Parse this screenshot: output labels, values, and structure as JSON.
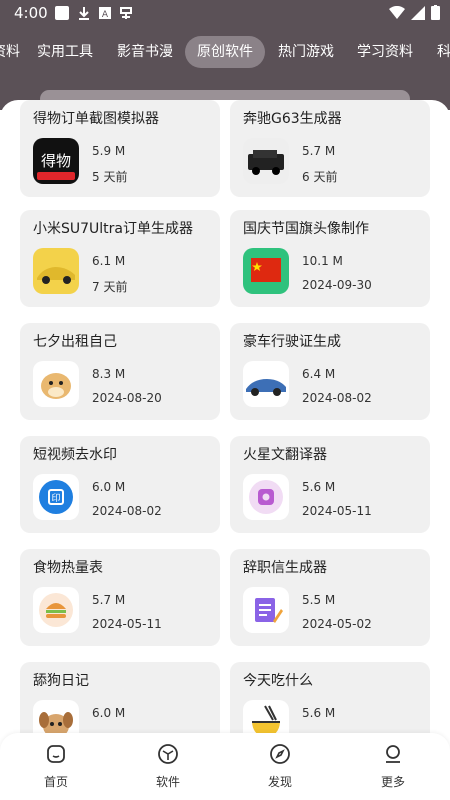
{
  "status_bar": {
    "time": "4:00"
  },
  "tabs": [
    {
      "label": "资料",
      "active": false
    },
    {
      "label": "实用工具",
      "active": false
    },
    {
      "label": "影音书漫",
      "active": false
    },
    {
      "label": "原创软件",
      "active": true
    },
    {
      "label": "热门游戏",
      "active": false
    },
    {
      "label": "学习资料",
      "active": false
    },
    {
      "label": "科",
      "active": false
    }
  ],
  "apps": [
    {
      "title": "得物订单截图模拟器",
      "size": "5.9 M",
      "date": "5 天前",
      "icon": "dewu-app-icon"
    },
    {
      "title": "奔驰G63生成器",
      "size": "5.7 M",
      "date": "6 天前",
      "icon": "g63-car-icon"
    },
    {
      "title": "小米SU7Ultra订单生成器",
      "size": "6.1 M",
      "date": "7 天前",
      "icon": "su7-car-icon"
    },
    {
      "title": "国庆节国旗头像制作",
      "size": "10.1 M",
      "date": "2024-09-30",
      "icon": "china-flag-icon"
    },
    {
      "title": "七夕出租自己",
      "size": "8.3 M",
      "date": "2024-08-20",
      "icon": "doge-icon"
    },
    {
      "title": "豪车行驶证生成",
      "size": "6.4 M",
      "date": "2024-08-02",
      "icon": "porsche-icon"
    },
    {
      "title": "短视频去水印",
      "size": "6.0 M",
      "date": "2024-08-02",
      "icon": "watermark-icon"
    },
    {
      "title": "火星文翻译器",
      "size": "5.6 M",
      "date": "2024-05-11",
      "icon": "translator-icon"
    },
    {
      "title": "食物热量表",
      "size": "5.7 M",
      "date": "2024-05-11",
      "icon": "burger-icon"
    },
    {
      "title": "辞职信生成器",
      "size": "5.5 M",
      "date": "2024-05-02",
      "icon": "letter-icon"
    },
    {
      "title": "舔狗日记",
      "size": "6.0 M",
      "date": "",
      "icon": "puppy-icon"
    },
    {
      "title": "今天吃什么",
      "size": "5.6 M",
      "date": "",
      "icon": "noodle-bowl-icon"
    }
  ],
  "bottom_nav": [
    {
      "label": "首页",
      "icon": "home-icon"
    },
    {
      "label": "软件",
      "icon": "cube-icon"
    },
    {
      "label": "发现",
      "icon": "compass-icon"
    },
    {
      "label": "更多",
      "icon": "user-icon"
    }
  ]
}
